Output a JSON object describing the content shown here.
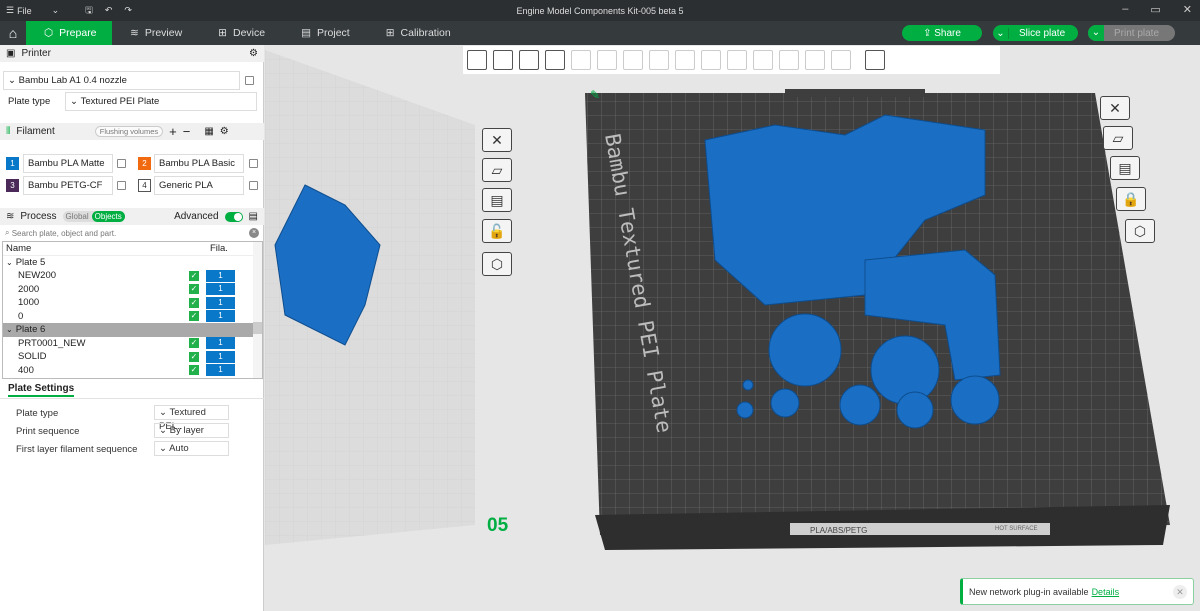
{
  "app": {
    "title": "Engine Model Components Kit-005 beta 5",
    "file_menu": "File"
  },
  "tabs": [
    {
      "label": "Prepare",
      "icon": "cube-icon"
    },
    {
      "label": "Preview",
      "icon": "layers-icon"
    },
    {
      "label": "Device",
      "icon": "device-icon"
    },
    {
      "label": "Project",
      "icon": "project-icon"
    },
    {
      "label": "Calibration",
      "icon": "calibration-icon"
    }
  ],
  "actions": {
    "share": "Share",
    "slice": "Slice plate",
    "print": "Print plate"
  },
  "printer": {
    "header": "Printer",
    "name": "Bambu Lab A1 0.4 nozzle",
    "plate_type_label": "Plate type",
    "plate_type": "Textured PEI Plate"
  },
  "filament": {
    "header": "Filament",
    "flushing": "Flushing volumes",
    "items": [
      {
        "num": "1",
        "name": "Bambu PLA Matte",
        "color": "#0a78c8"
      },
      {
        "num": "2",
        "name": "Bambu PLA Basic",
        "color": "#f26a10"
      },
      {
        "num": "3",
        "name": "Bambu PETG-CF",
        "color": "#4b2a5a"
      },
      {
        "num": "4",
        "name": "Generic PLA",
        "color": "#ffffff"
      }
    ]
  },
  "process": {
    "header": "Process",
    "global": "Global",
    "objects": "Objects",
    "advanced": "Advanced",
    "advanced_on": true,
    "search_placeholder": "Search plate, object and part."
  },
  "objects": {
    "col_name": "Name",
    "col_fila": "Fila.",
    "rows": [
      {
        "type": "plate",
        "name": "Plate 5"
      },
      {
        "type": "obj",
        "name": "NEW200",
        "fila": "1"
      },
      {
        "type": "obj",
        "name": "2000",
        "fila": "1"
      },
      {
        "type": "obj",
        "name": "1000",
        "fila": "1"
      },
      {
        "type": "obj",
        "name": "0",
        "fila": "1"
      },
      {
        "type": "plate",
        "name": "Plate 6",
        "selected": true
      },
      {
        "type": "obj",
        "name": "PRT0001_NEW",
        "fila": "1"
      },
      {
        "type": "obj",
        "name": "SOLID",
        "fila": "1"
      },
      {
        "type": "obj",
        "name": "400",
        "fila": "1"
      }
    ]
  },
  "plate_settings": {
    "header": "Plate Settings",
    "rows": [
      {
        "label": "Plate type",
        "value": "Textured PEI..."
      },
      {
        "label": "Print sequence",
        "value": "By layer"
      },
      {
        "label": "First layer filament sequence",
        "value": "Auto"
      }
    ]
  },
  "viewport": {
    "plate_label": "Bambu Textured PEI Plate",
    "plate_num_left": "05",
    "bed_strip": "PLA/ABS/PETG",
    "hot_surface": "HOT SURFACE",
    "part_color": "#1a6fc4",
    "accent": "#00ae42"
  },
  "notification": {
    "text": "New network plug-in available",
    "link": "Details"
  }
}
